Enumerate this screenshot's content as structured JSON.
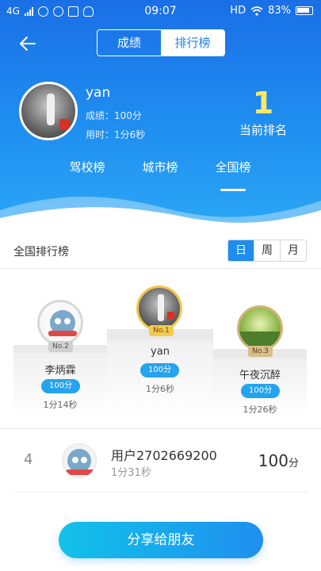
{
  "status_bar": {
    "network": "4G",
    "time": "09:07",
    "hd": "HD",
    "battery": "83%"
  },
  "header": {
    "segments": [
      "成绩",
      "排行榜"
    ],
    "active_segment": 1,
    "user": {
      "name": "yan",
      "score_line": "成绩：100分",
      "time_line": "用时：1分6秒"
    },
    "rank_value": "1",
    "rank_label": "当前排名",
    "tabs": [
      "驾校榜",
      "城市榜",
      "全国榜"
    ],
    "active_tab": 2
  },
  "board": {
    "title": "全国排行榜",
    "periods": [
      "日",
      "周",
      "月"
    ],
    "active_period": 0
  },
  "podium": {
    "first": {
      "badge": "No.1",
      "name": "yan",
      "score": "100分",
      "time": "1分6秒"
    },
    "second": {
      "badge": "No.2",
      "name": "李炳霖",
      "score": "100分",
      "time": "1分14秒"
    },
    "third": {
      "badge": "No.3",
      "name": "午夜沉醉",
      "score": "100分",
      "time": "1分26秒"
    }
  },
  "list": [
    {
      "rank": "4",
      "name": "用户2702669200",
      "time": "1分31秒",
      "score": "100",
      "unit": "分"
    }
  ],
  "share_button": "分享给朋友",
  "colors": {
    "header_blue": "#1f8ef0",
    "accent": "#26a3ef",
    "rank_yellow": "#ffe866"
  }
}
